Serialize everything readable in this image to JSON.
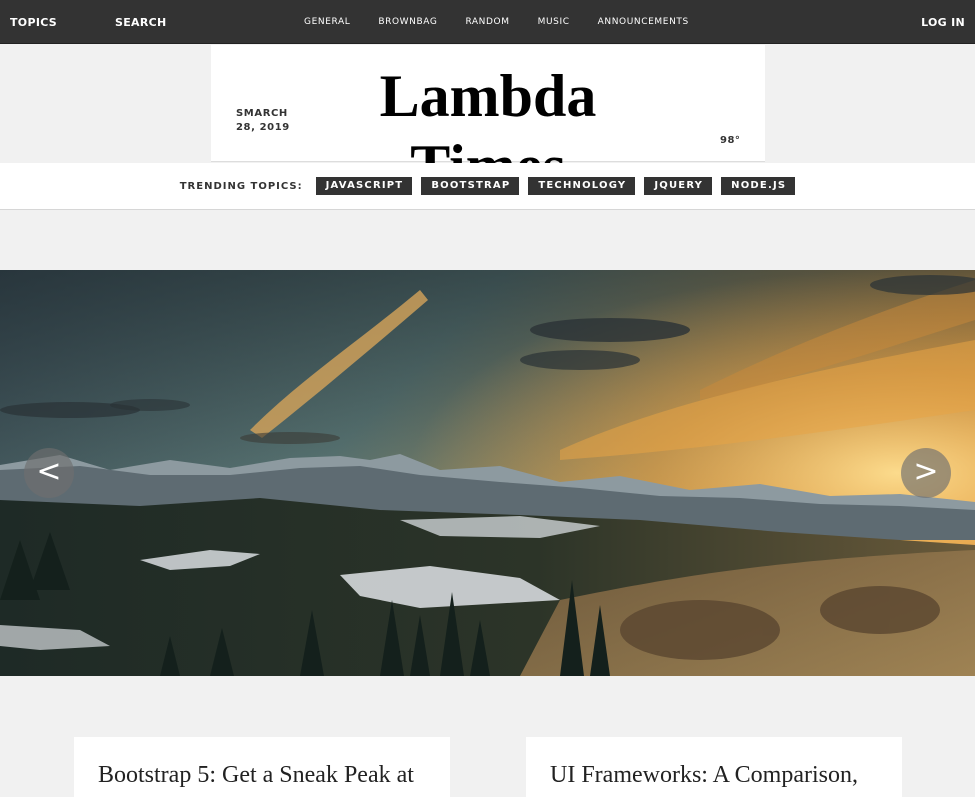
{
  "top_bar": {
    "topics_label": "TOPICS",
    "search_label": "SEARCH",
    "nav": [
      "GENERAL",
      "BROWNBAG",
      "RANDOM",
      "MUSIC",
      "ANNOUNCEMENTS"
    ],
    "login_label": "LOG IN"
  },
  "masthead": {
    "date": "SMARCH 28, 2019",
    "title": "Lambda Times",
    "temperature": "98°"
  },
  "trending": {
    "label": "TRENDING TOPICS:",
    "tags": [
      "JAVASCRIPT",
      "BOOTSTRAP",
      "TECHNOLOGY",
      "JQUERY",
      "NODE.JS"
    ]
  },
  "carousel": {
    "prev_label": "<",
    "next_label": ">",
    "image": "mountain-landscape-sunset"
  },
  "cards": [
    {
      "title": "Bootstrap 5: Get a Sneak Peak at"
    },
    {
      "title": "UI Frameworks: A Comparison,"
    }
  ],
  "colors": {
    "topbar_bg": "#333333",
    "page_bg": "#f1f1f1",
    "tag_bg": "#333333",
    "surface": "#ffffff"
  }
}
